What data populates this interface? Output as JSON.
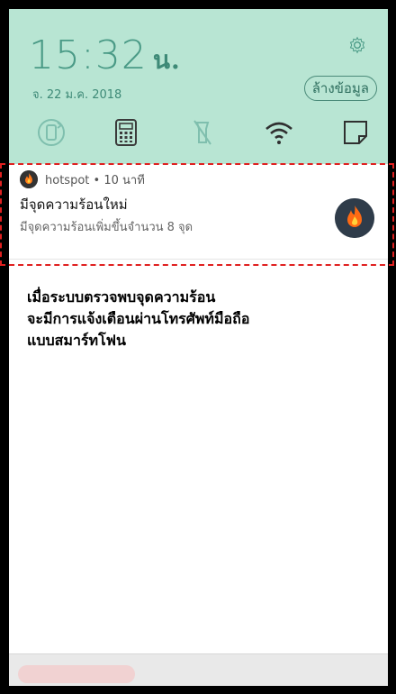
{
  "status": {
    "time": "15:32",
    "time_suffix": "น.",
    "date": "จ. 22 ม.ค. 2018",
    "clear_button": "ล้างข้อมูล"
  },
  "quick_settings": [
    {
      "icon": "screen-rotation-icon"
    },
    {
      "icon": "calculator-icon"
    },
    {
      "icon": "flashlight-off-icon"
    },
    {
      "icon": "wifi-icon"
    },
    {
      "icon": "note-icon"
    }
  ],
  "notification": {
    "app": "hotspot",
    "separator": "•",
    "age": "10 นาที",
    "title": "มีจุดความร้อนใหม่",
    "body": "มีจุดความร้อนเพิ่มขึ้นจำนวน 8 จุด"
  },
  "caption": {
    "line1": "เมื่อระบบตรวจพบจุดความร้อน",
    "line2": "จะมีการแจ้งเตือนผ่านโทรศัพท์มือถือ",
    "line3": "แบบสมาร์ทโฟน"
  },
  "colors": {
    "quick_settings_bg": "#b8e5d3",
    "accent": "#3e8a77",
    "highlight_dash": "#e02020",
    "fire_icon_bg": "#2f3c4a"
  }
}
